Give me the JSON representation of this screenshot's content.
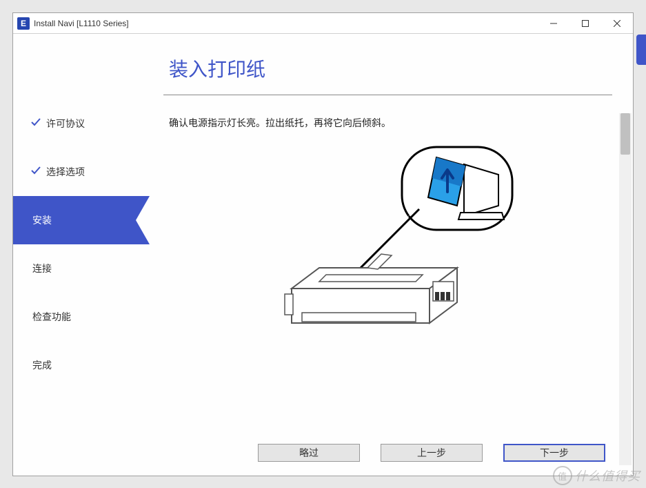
{
  "window": {
    "app_icon_letter": "E",
    "title": "Install Navi [L1110 Series]"
  },
  "sidebar": {
    "steps": [
      {
        "label": "许可协议",
        "state": "done"
      },
      {
        "label": "选择选项",
        "state": "done"
      },
      {
        "label": "安装",
        "state": "active"
      },
      {
        "label": "连接",
        "state": "pending"
      },
      {
        "label": "检查功能",
        "state": "pending"
      },
      {
        "label": "完成",
        "state": "pending"
      }
    ]
  },
  "main": {
    "title": "装入打印纸",
    "instruction": "确认电源指示灯长亮。拉出纸托，再将它向后倾斜。"
  },
  "buttons": {
    "skip": "略过",
    "back": "上一步",
    "next": "下一步"
  },
  "watermark": {
    "icon_text": "值",
    "text": "什么值得买"
  }
}
